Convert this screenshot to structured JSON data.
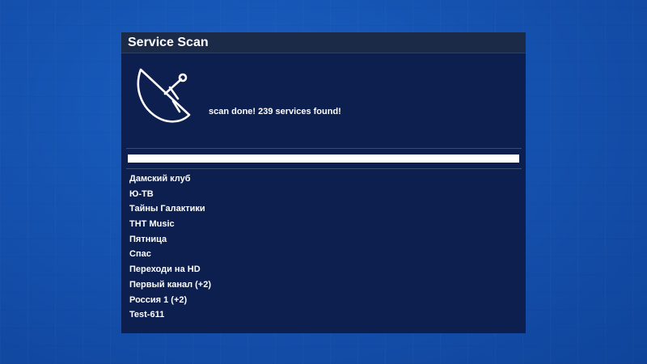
{
  "window": {
    "title": "Service Scan"
  },
  "scan": {
    "status_text": "scan done! 239 services found!",
    "progress": 1.0,
    "icon": "satellite-dish-icon"
  },
  "services": [
    "Дамский клуб",
    "Ю-ТВ",
    "Тайны Галактики",
    "THT Music",
    "Пятница",
    "Спас",
    "Переходи на HD",
    "Первый канал (+2)",
    "Россия 1 (+2)",
    "Test-611"
  ],
  "colors": {
    "background": "#1552b0",
    "window_bg": "#0d1f4e",
    "title_bar_bg": "#1b2a47",
    "text": "#ffffff",
    "progress_fill": "#ffffff"
  }
}
